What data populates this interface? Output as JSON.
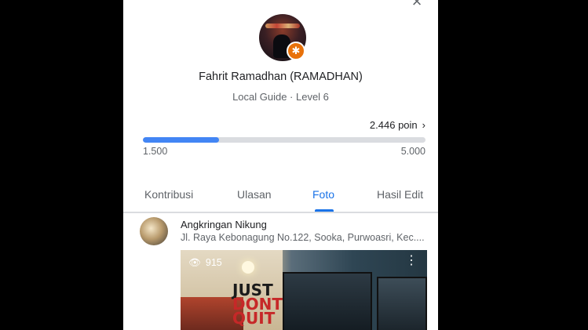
{
  "profile": {
    "name": "Fahrit Ramadhan (RAMADHAN)",
    "level": "Local Guide · Level 6"
  },
  "points": {
    "label": "2.446 poin",
    "min_label": "1.500",
    "max_label": "5.000",
    "progress_fraction": 0.27
  },
  "tabs": [
    {
      "label": "Kontribusi"
    },
    {
      "label": "Ulasan"
    },
    {
      "label": "Foto"
    },
    {
      "label": "Hasil Edit"
    }
  ],
  "active_tab": "Foto",
  "place": {
    "name": "Angkringan Nikung",
    "address": "Jl. Raya Kebonagung No.122, Sooka, Purwoasri, Kec....",
    "views": "915"
  },
  "colors": {
    "accent": "#1a73e8",
    "progress": "#4285f4",
    "badge": "#e8710a"
  },
  "icons": {
    "close": "close-icon",
    "badge": "star-badge-icon",
    "chevron": "chevron-right-icon",
    "views": "eye-icon",
    "more": "more-vert-icon"
  }
}
